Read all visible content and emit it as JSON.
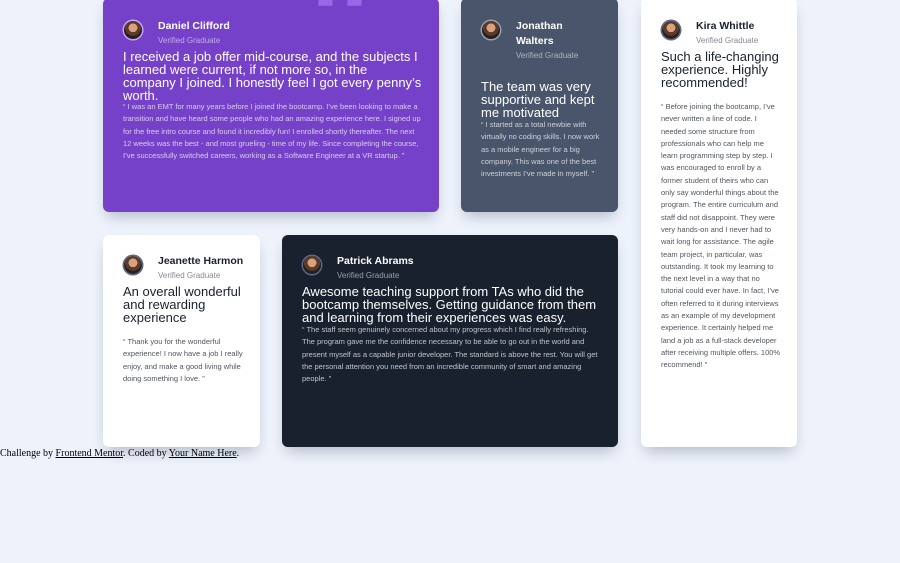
{
  "testimonials": {
    "daniel": {
      "name": "Daniel Clifford",
      "status": "Verified Graduate",
      "headline": "I received a job offer mid-course, and the subjects I learned were current, if not more so, in the company I joined. I honestly feel I got every penny’s worth.",
      "body": "“ I was an EMT for many years before I joined the bootcamp. I’ve been looking to make a transition and have heard some people who had an amazing experience here. I signed up for the free intro course and found it incredibly fun! I enrolled shortly thereafter. The next 12 weeks was the best - and most grueling - time of my life. Since completing the course, I’ve successfully switched careers, working as a Software Engineer at a VR startup. ”"
    },
    "jonathan": {
      "name": "Jonathan Walters",
      "status": "Verified Graduate",
      "headline": "The team was very supportive and kept me motivated",
      "body": "“ I started as a total newbie with virtually no coding skills. I now work as a mobile engineer for a big company. This was one of the best investments I’ve made in myself. ”"
    },
    "kira": {
      "name": "Kira Whittle",
      "status": "Verified Graduate",
      "headline": "Such a life-changing experience. Highly recommended!",
      "body": "“ Before joining the bootcamp, I’ve never written a line of code. I needed some structure from professionals who can help me learn programming step by step. I was encouraged to enroll by a former student of theirs who can only say wonderful things about the program. The entire curriculum and staff did not disappoint. They were very hands-on and I never had to wait long for assistance. The agile team project, in particular, was outstanding. It took my learning to the next level in a way that no tutorial could ever have. In fact, I’ve often referred to it during interviews as an example of my development experience. It certainly helped me land a job as a full-stack developer after receiving multiple offers. 100% recommend! ”"
    },
    "jeanette": {
      "name": "Jeanette Harmon",
      "status": "Verified Graduate",
      "headline": "An overall wonderful and rewarding experience",
      "body": "“ Thank you for the wonderful experience! I now have a job I really enjoy, and make a good living while doing something I love. ”"
    },
    "patrick": {
      "name": "Patrick Abrams",
      "status": "Verified Graduate",
      "headline": "Awesome teaching support from TAs who did the bootcamp themselves. Getting guidance from them and learning from their experiences was easy.",
      "body": "“ The staff seem genuinely concerned about my progress which I find really refreshing. The program gave me the confidence necessary to be able to go out in the world and present myself as a capable junior developer. The standard is above the rest. You will get the personal attention you need from an incredible community of smart and amazing people. ”"
    }
  },
  "footer": {
    "prefix": "Challenge by ",
    "frontend_mentor_link": "Frontend Mentor",
    "middle": ". Coded by ",
    "author_link": "Your Name Here",
    "suffix": "."
  },
  "colors": {
    "background": "#edf2fb",
    "purple_card": "#7541c8",
    "grey_card": "#48556a",
    "dark_card": "#19212e",
    "white_card": "#ffffff"
  }
}
